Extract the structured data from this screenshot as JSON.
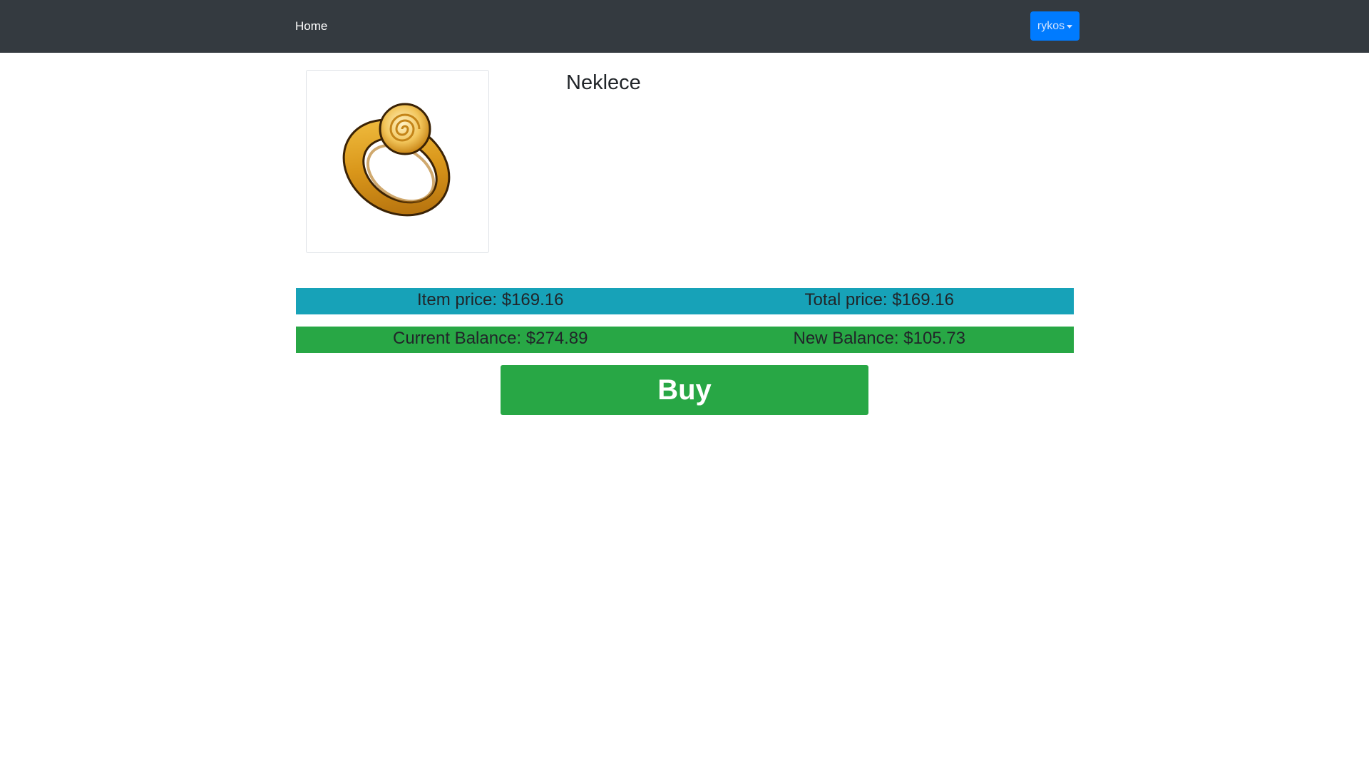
{
  "navbar": {
    "home_label": "Home",
    "user_label": "rykos"
  },
  "product": {
    "title": "Neklece",
    "image_icon": "gold-ring-image"
  },
  "pricing": {
    "item_price": "Item price: $169.16",
    "total_price": "Total price: $169.16",
    "current_balance": "Current Balance: $274.89",
    "new_balance": "New Balance: $105.73"
  },
  "actions": {
    "buy_label": "Buy"
  },
  "colors": {
    "navbar": "#343a40",
    "primary": "#007bff",
    "info": "#17a2b8",
    "success": "#28a745"
  }
}
